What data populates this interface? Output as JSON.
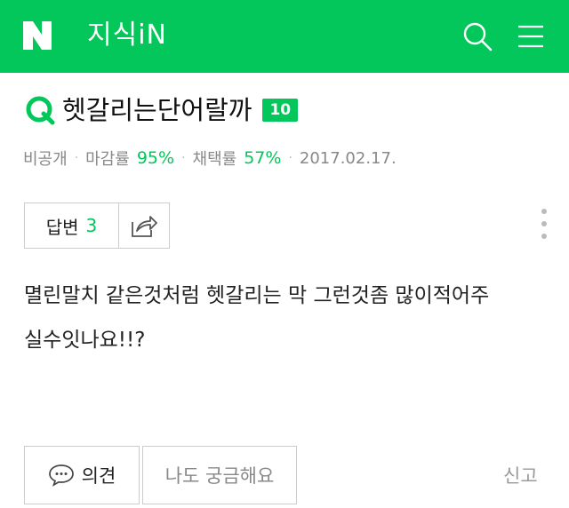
{
  "header": {
    "logo_icon": "naver-n-logo-icon",
    "service_name": "지식iN",
    "search_icon": "search-icon",
    "menu_icon": "hamburger-menu-icon",
    "brand_color": "#03c75a"
  },
  "question": {
    "q_icon": "q-mark-icon",
    "title": "헷갈리는단어랄까",
    "level": "10",
    "meta": {
      "privacy": "비공개",
      "close_rate_label": "마감률",
      "close_rate": "95%",
      "adopt_rate_label": "채택률",
      "adopt_rate": "57%",
      "date": "2017.02.17."
    },
    "answers": {
      "label": "답변",
      "count": "3",
      "share_icon": "share-icon"
    },
    "more_icon": "more-vertical-icon",
    "body": "멸린말치 같은것처럼 헷갈리는 막 그런것좀 많이적어주\n실수잇나요!!?"
  },
  "actions": {
    "comment_icon": "speech-bubble-icon",
    "comment_label": "의견",
    "curious_label": "나도 궁금해요",
    "report_label": "신고"
  }
}
